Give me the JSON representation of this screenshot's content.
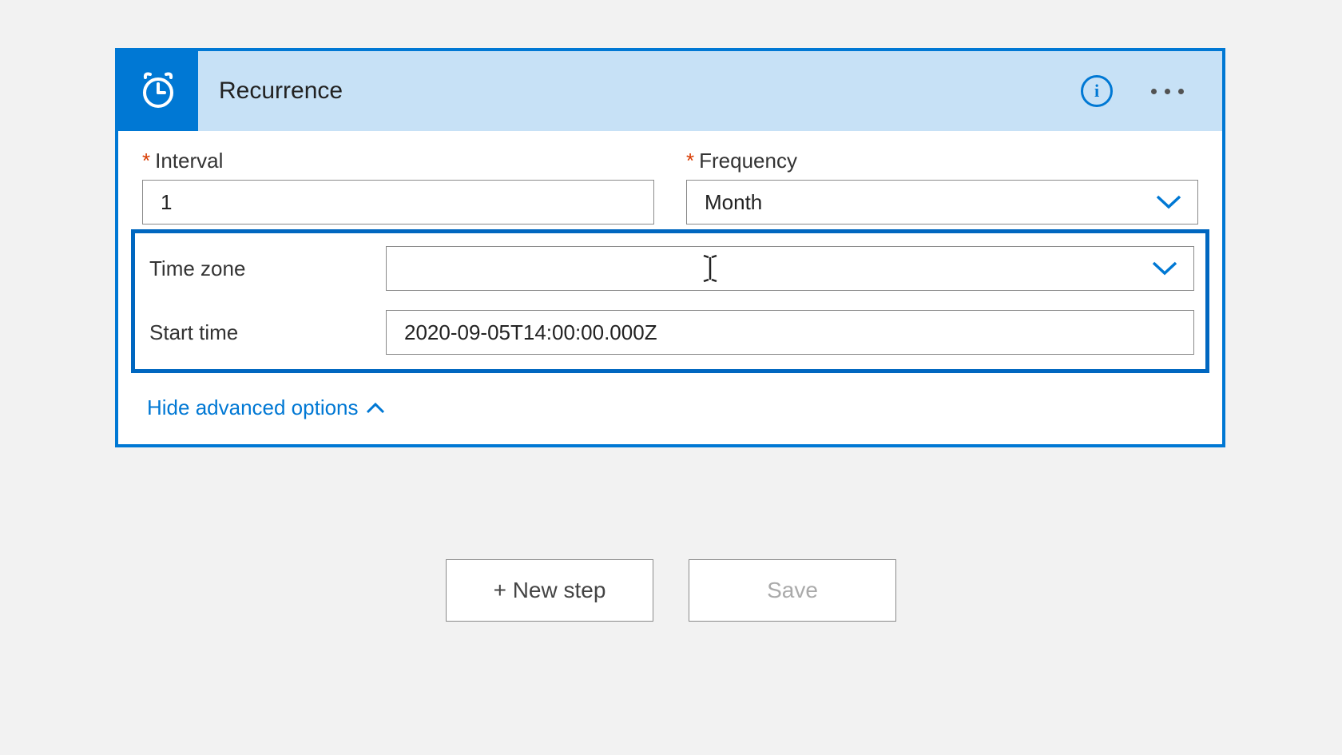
{
  "card": {
    "title": "Recurrence",
    "labels": {
      "interval": "Interval",
      "frequency": "Frequency",
      "timezone": "Time zone",
      "starttime": "Start time"
    },
    "values": {
      "interval": "1",
      "frequency": "Month",
      "timezone": "",
      "starttime": "2020-09-05T14:00:00.000Z"
    },
    "toggle": "Hide advanced options"
  },
  "actions": {
    "newstep": "+ New step",
    "save": "Save"
  }
}
